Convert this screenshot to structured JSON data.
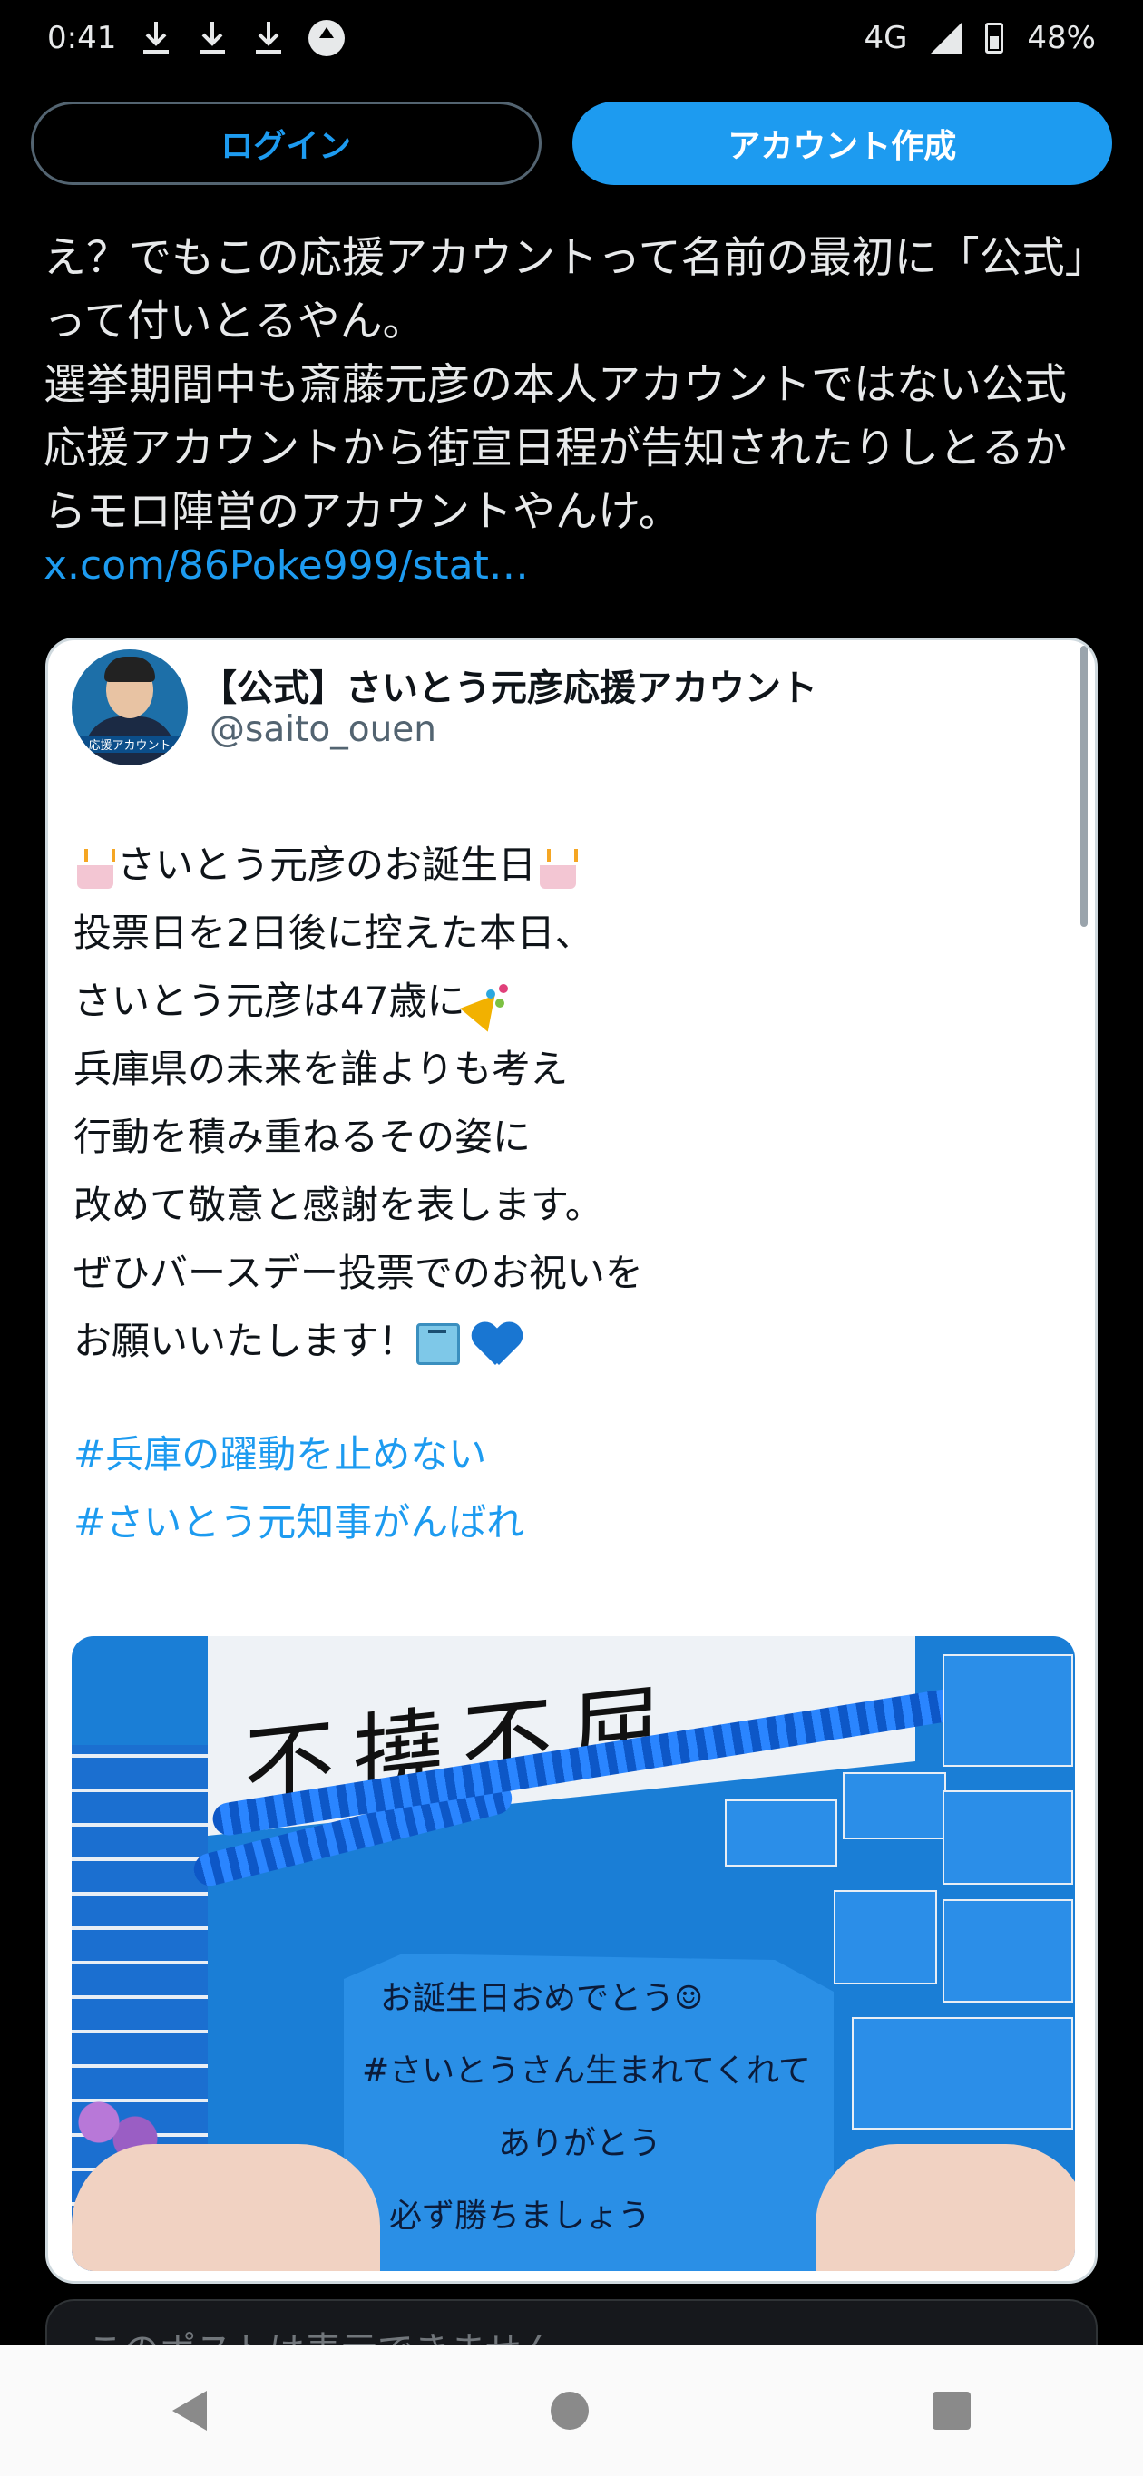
{
  "status_bar": {
    "time": "0:41",
    "network": "4G",
    "battery": "48%",
    "icons": [
      "download-icon",
      "download-icon",
      "download-icon",
      "upload-icon",
      "signal-icon",
      "battery-icon"
    ]
  },
  "auth": {
    "login_label": "ログイン",
    "signup_label": "アカウント作成"
  },
  "tweet": {
    "text": "え？でもこの応援アカウントって名前の最初に「公式」って付いとるやん。\n選挙期間中も斎藤元彦の本人アカウントではない公式応援アカウントから街宣日程が告知されたりしとるからモロ陣営のアカウントやんけ。",
    "link": "x.com/86Poke999/stat…"
  },
  "quote": {
    "name": "【公式】さいとう元彦応援アカウント",
    "handle": "@saito_ouen",
    "avatar_tag": "応援アカウント",
    "lines": [
      "さいとう元彦のお誕生日",
      "投票日を2日後に控えた本日、",
      "さいとう元彦は47歳に",
      "兵庫県の未来を誰よりも考え",
      "行動を積み重ねるその姿に",
      "改めて敬意と感謝を表します。",
      "ぜひバースデー投票でのお祝いを",
      "お願いいたします！"
    ],
    "hashtags": [
      "#兵庫の躍動を止めない",
      "#さいとう元知事がんばれ"
    ],
    "image": {
      "note_lines": [
        "お誕生日おめでとう☺",
        "#さいとうさん生まれてくれて",
        "ありがとう",
        "必ず勝ちましょう"
      ],
      "banner_text": "不撓不屈"
    }
  },
  "next_card": {
    "text": "このポストは表示できません。"
  },
  "colors": {
    "accent": "#1d9bf0",
    "background": "#000000",
    "card": "#ffffff"
  }
}
